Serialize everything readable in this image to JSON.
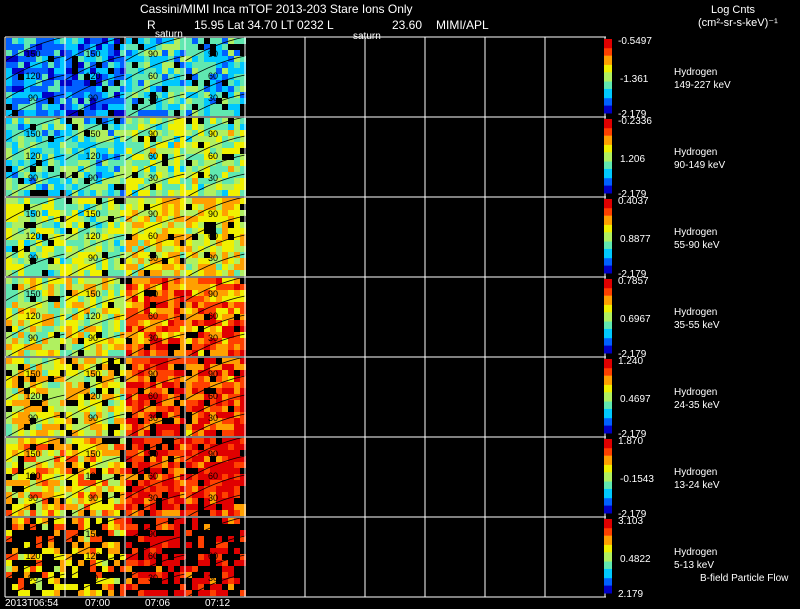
{
  "header": {
    "title": "Cassini/MIMI Inca mTOF  2013-203   Stare   Ions Only",
    "line2_r": "R",
    "line2_info": "15.95 Lat 34.70 LT 0232 L",
    "line2_l": "23.60",
    "line2_src": "MIMI/APL",
    "saturn_1": "saturn",
    "saturn_2": "saturn",
    "units_1": "Log Cnts",
    "units_2": "(cm²-sr-s-keV)⁻¹"
  },
  "footer": {
    "flow_label": "B-field Particle Flow"
  },
  "chart_data": {
    "type": "heatmap",
    "title": "Cassini/MIMI Inca mTOF  2013-203   Stare   Ions Only",
    "x_tick_labels": [
      "2013T06:54",
      "07:00",
      "07:06",
      "07:12"
    ],
    "contour_labels": [
      "150",
      "120",
      "90",
      "60",
      "30",
      "0"
    ],
    "colorscale": [
      "#0000c8",
      "#0060ff",
      "#00c8ff",
      "#60e8b0",
      "#b0f060",
      "#f0f000",
      "#ffa000",
      "#ff4000",
      "#e00000"
    ],
    "panels": [
      {
        "species": "Hydrogen",
        "energy": "149-227 keV",
        "cmax": "-0.5497",
        "cmid": "-1.361",
        "cmin": "-2.179",
        "level": 0.22
      },
      {
        "species": "Hydrogen",
        "energy": "90-149 keV",
        "cmax": "-0.2336",
        "cmid": "1.206",
        "cmin": "-2.179",
        "level": 0.38
      },
      {
        "species": "Hydrogen",
        "energy": "55-90 keV",
        "cmax": "0.4037",
        "cmid": "0.8877",
        "cmin": "-2.179",
        "level": 0.48
      },
      {
        "species": "Hydrogen",
        "energy": "35-55 keV",
        "cmax": "0.7857",
        "cmid": "0.6967",
        "cmin": "-2.179",
        "level": 0.55
      },
      {
        "species": "Hydrogen",
        "energy": "24-35 keV",
        "cmax": "1.240",
        "cmid": "0.4697",
        "cmin": "-2.179",
        "level": 0.6
      },
      {
        "species": "Hydrogen",
        "energy": "13-24 keV",
        "cmax": "1.870",
        "cmid": "-0.1543",
        "cmin": "-2.179",
        "level": 0.66
      },
      {
        "species": "Hydrogen",
        "energy": "5-13 keV",
        "cmax": "3.103",
        "cmid": "0.4822",
        "cmin": "2.179",
        "level": 0.7
      }
    ],
    "grid": true
  }
}
